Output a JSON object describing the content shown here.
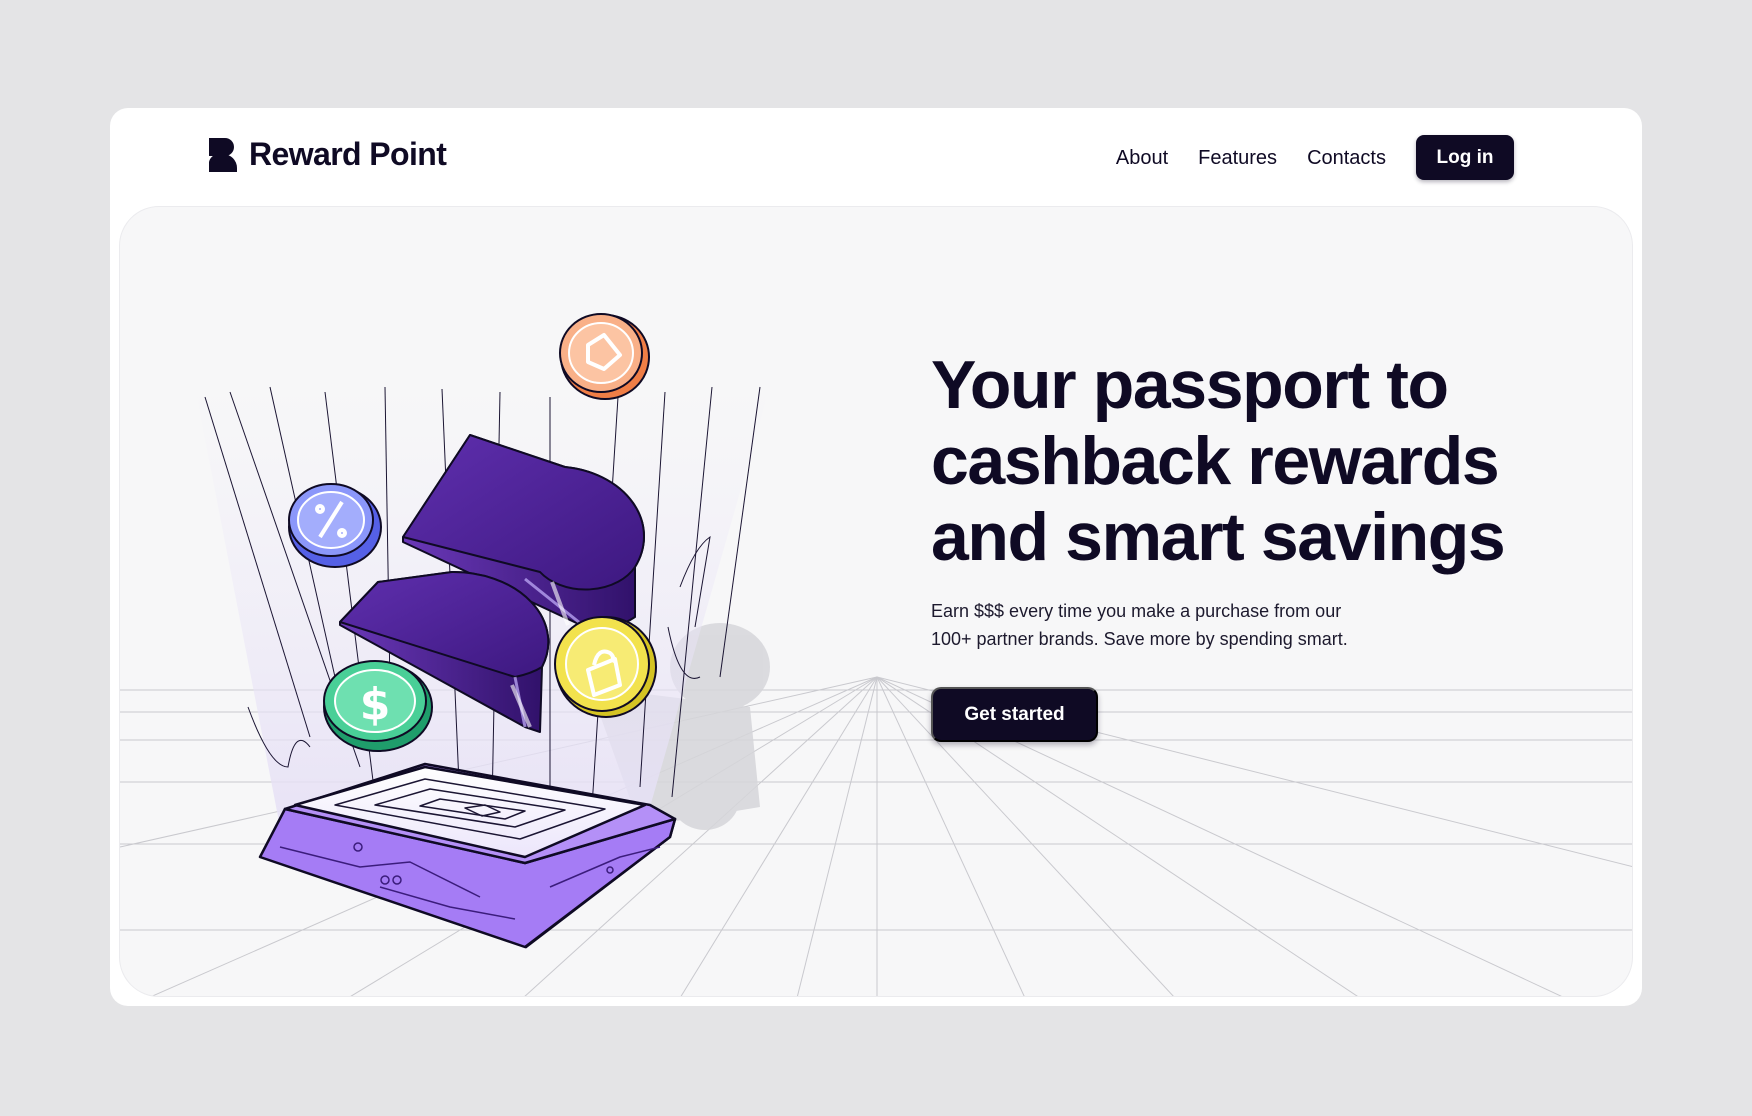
{
  "brand": {
    "name": "Reward Point",
    "color": "#0f0a24"
  },
  "nav": {
    "links": [
      "About",
      "Features",
      "Contacts"
    ],
    "login_label": "Log in"
  },
  "hero": {
    "headline_lines": [
      "Your passport to",
      "cashback rewards",
      "and smart savings"
    ],
    "subtitle_lines": [
      "Earn $$$ every time you make a purchase from our",
      "100+ partner brands. Save more by spending smart."
    ],
    "cta_label": "Get started"
  },
  "illustration": {
    "icons": [
      "percent-coin-icon",
      "tag-coin-icon",
      "dollar-coin-icon",
      "lock-coin-icon",
      "brand-3d-logo",
      "platform-base"
    ]
  },
  "colors": {
    "dark": "#0f0a24",
    "page_bg": "#e4e4e6",
    "hero_bg": "#f7f7f8",
    "purple": "#5b2aa6",
    "platform_purple": "#9a6cf2",
    "coin_blue": "#7f8ef7",
    "coin_orange": "#f7a97a",
    "coin_green": "#3cc58d",
    "coin_yellow": "#f2e24d"
  }
}
